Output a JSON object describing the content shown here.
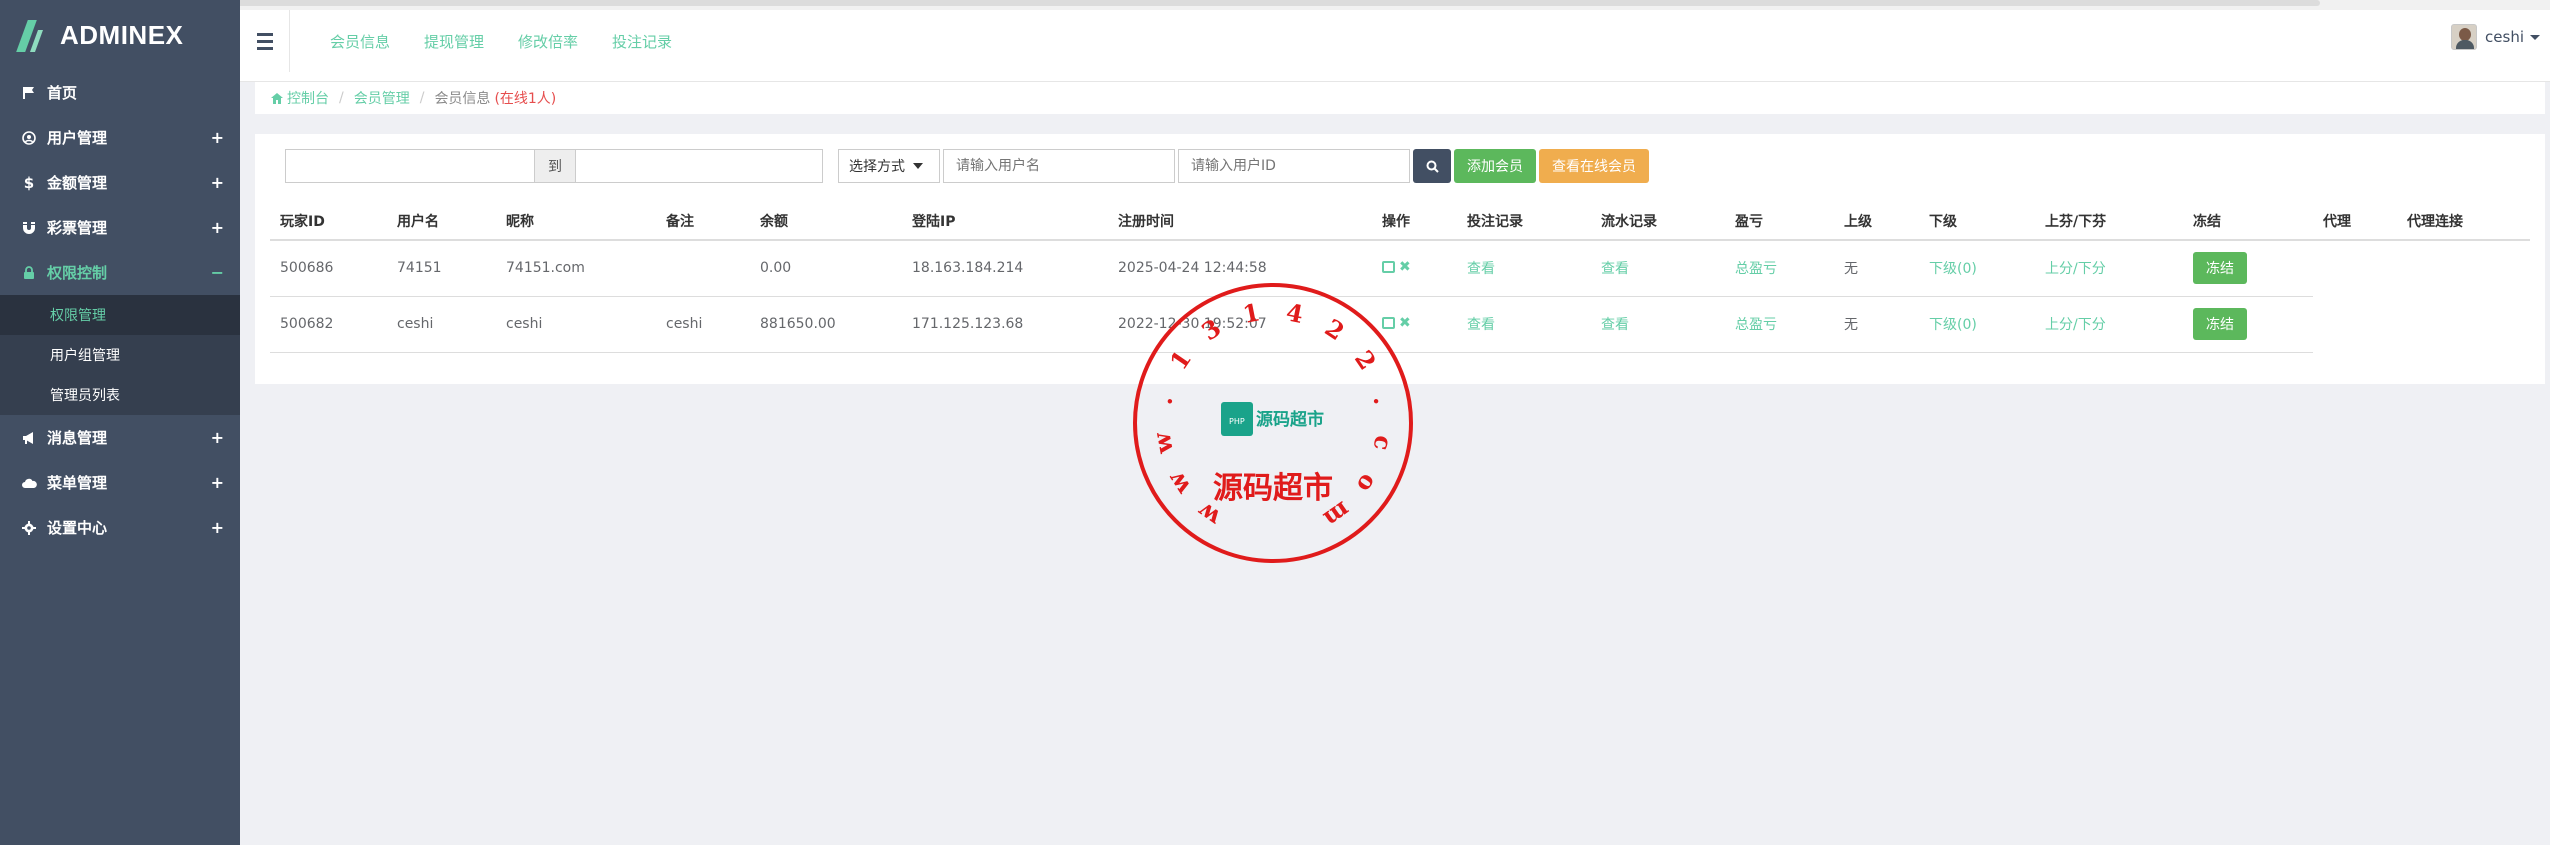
{
  "brand": {
    "logo_text": "ADMINEX"
  },
  "sidebar": {
    "items": [
      {
        "label": "首页",
        "icon": "flag-icon",
        "expandable": false
      },
      {
        "label": "用户管理",
        "icon": "user-circle-icon",
        "expandable": true,
        "toggle": "+"
      },
      {
        "label": "金额管理",
        "icon": "dollar-icon",
        "expandable": true,
        "toggle": "+"
      },
      {
        "label": "彩票管理",
        "icon": "magnet-icon",
        "expandable": true,
        "toggle": "+"
      },
      {
        "label": "权限控制",
        "icon": "lock-icon",
        "expandable": true,
        "toggle": "−",
        "active": true,
        "children": [
          {
            "label": "权限管理",
            "active": true
          },
          {
            "label": "用户组管理"
          },
          {
            "label": "管理员列表"
          }
        ]
      },
      {
        "label": "消息管理",
        "icon": "bullhorn-icon",
        "expandable": true,
        "toggle": "+"
      },
      {
        "label": "菜单管理",
        "icon": "cloud-icon",
        "expandable": true,
        "toggle": "+"
      },
      {
        "label": "设置中心",
        "icon": "gear-icon",
        "expandable": true,
        "toggle": "+"
      }
    ]
  },
  "header": {
    "nav": [
      "会员信息",
      "提现管理",
      "修改倍率",
      "投注记录"
    ],
    "user_name": "ceshi"
  },
  "breadcrumb": {
    "items": [
      "控制台",
      "会员管理",
      "会员信息"
    ],
    "online": "(在线1人)"
  },
  "filters": {
    "date_to_label": "到",
    "select_label": "选择方式",
    "username_placeholder": "请输入用户名",
    "userid_placeholder": "请输入用户ID",
    "add_member": "添加会员",
    "view_online": "查看在线会员"
  },
  "table": {
    "headers": [
      "玩家ID",
      "用户名",
      "昵称",
      "备注",
      "余额",
      "登陆IP",
      "注册时间",
      "操作",
      "投注记录",
      "流水记录",
      "盈亏",
      "上级",
      "下级",
      "上芬/下芬",
      "冻结",
      "代理",
      "代理连接"
    ],
    "rows": [
      {
        "id": "500686",
        "username": "74151",
        "nickname": "74151.com",
        "remark": "",
        "balance": "0.00",
        "ip": "18.163.184.214",
        "reg_time": "2025-04-24 12:44:58",
        "bets": "查看",
        "flow": "查看",
        "pl": "总盈亏",
        "parent": "无",
        "children": "下级(0)",
        "points": "上分/下分",
        "freeze": "冻结"
      },
      {
        "id": "500682",
        "username": "ceshi",
        "nickname": "ceshi",
        "remark": "ceshi",
        "balance": "881650.00",
        "ip": "171.125.123.68",
        "reg_time": "2022-12-30 19:52:07",
        "bets": "查看",
        "flow": "查看",
        "pl": "总盈亏",
        "parent": "无",
        "children": "下级(0)",
        "points": "上分/下分",
        "freeze": "冻结"
      }
    ]
  },
  "watermark": {
    "ring_text": "www.131422.com",
    "bottom_text": "源码超市",
    "logo_text": "源码超市",
    "color": "#e01b1b"
  },
  "colors": {
    "sidebar": "#424f63",
    "accent": "#65cea7",
    "green": "#5cb85c",
    "orange": "#f0ad4e"
  }
}
